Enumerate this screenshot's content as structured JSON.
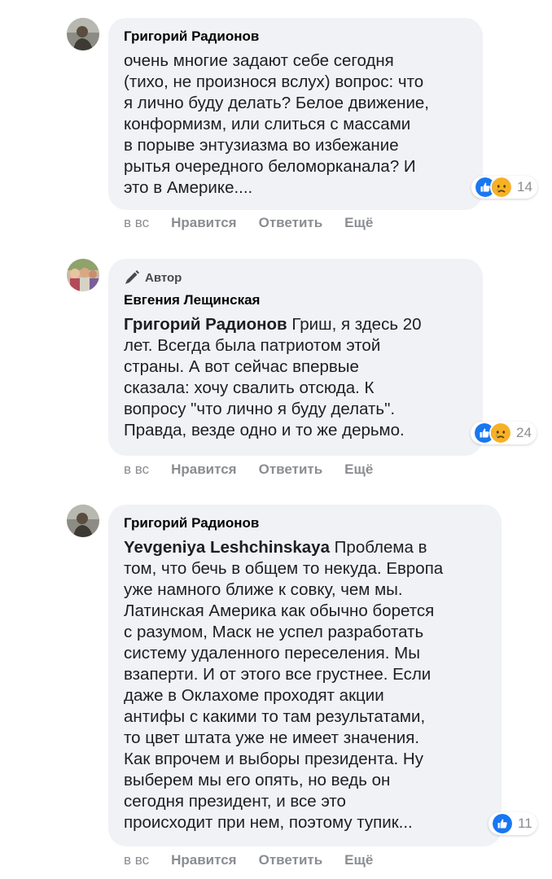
{
  "comments": [
    {
      "author": "Григорий Радионов",
      "author_badge": "",
      "mention": "",
      "lines": [
        "очень многие задают себе сегодня",
        "(тихо, не произнося вслух) вопрос: что",
        "я лично буду делать? Белое движение,",
        "конформизм, или слиться с массами",
        "в порыве энтузиазма во избежание",
        "рытья очередного беломорканала? И",
        "это в Америке...."
      ],
      "reactions": [
        "like",
        "sad"
      ],
      "reaction_count": "14",
      "time": "в вс",
      "like_label": "Нравится",
      "reply_label": "Ответить",
      "more_label": "Ещё"
    },
    {
      "author": "Евгения Лещинская",
      "author_badge": "Автор",
      "mention": "Григорий Радионов",
      "lines": [
        " Гриш, я здесь 20",
        "лет. Всегда была патриотом этой",
        "страны. А вот сейчас впервые",
        "сказала: хочу свалить отсюда. К",
        "вопросу \"что лично я буду делать\".",
        "Правда, везде одно и то же дерьмо."
      ],
      "reactions": [
        "like",
        "sad"
      ],
      "reaction_count": "24",
      "time": "в вс",
      "like_label": "Нравится",
      "reply_label": "Ответить",
      "more_label": "Ещё"
    },
    {
      "author": "Григорий Радионов",
      "author_badge": "",
      "mention": "Yevgeniya Leshchinskaya",
      "lines": [
        " Проблема в",
        "том, что бечь в общем то некуда. Европа",
        "уже намного ближе к совку, чем мы.",
        "Латинская Америка как обычно борется",
        "с разумом, Маск не успел разработать",
        "систему удаленного переселения. Мы",
        "взаперти. И от этого все грустнее. Если",
        "даже в Оклахоме проходят акции",
        "антифы с какими то там результатами,",
        "то цвет штата уже не имеет значения.",
        "Как впрочем и выборы президента. Ну",
        "выберем мы его опять, но ведь он",
        "сегодня президент, и все это",
        "происходит при нем, поэтому тупик..."
      ],
      "reactions": [
        "like"
      ],
      "reaction_count": "11",
      "time": "в вс",
      "like_label": "Нравится",
      "reply_label": "Ответить",
      "more_label": "Ещё"
    }
  ],
  "colors": {
    "bubble": "#f0f2f5",
    "like": "#1877f2",
    "sad": "#f7b125",
    "meta_text": "#8a8d91"
  }
}
